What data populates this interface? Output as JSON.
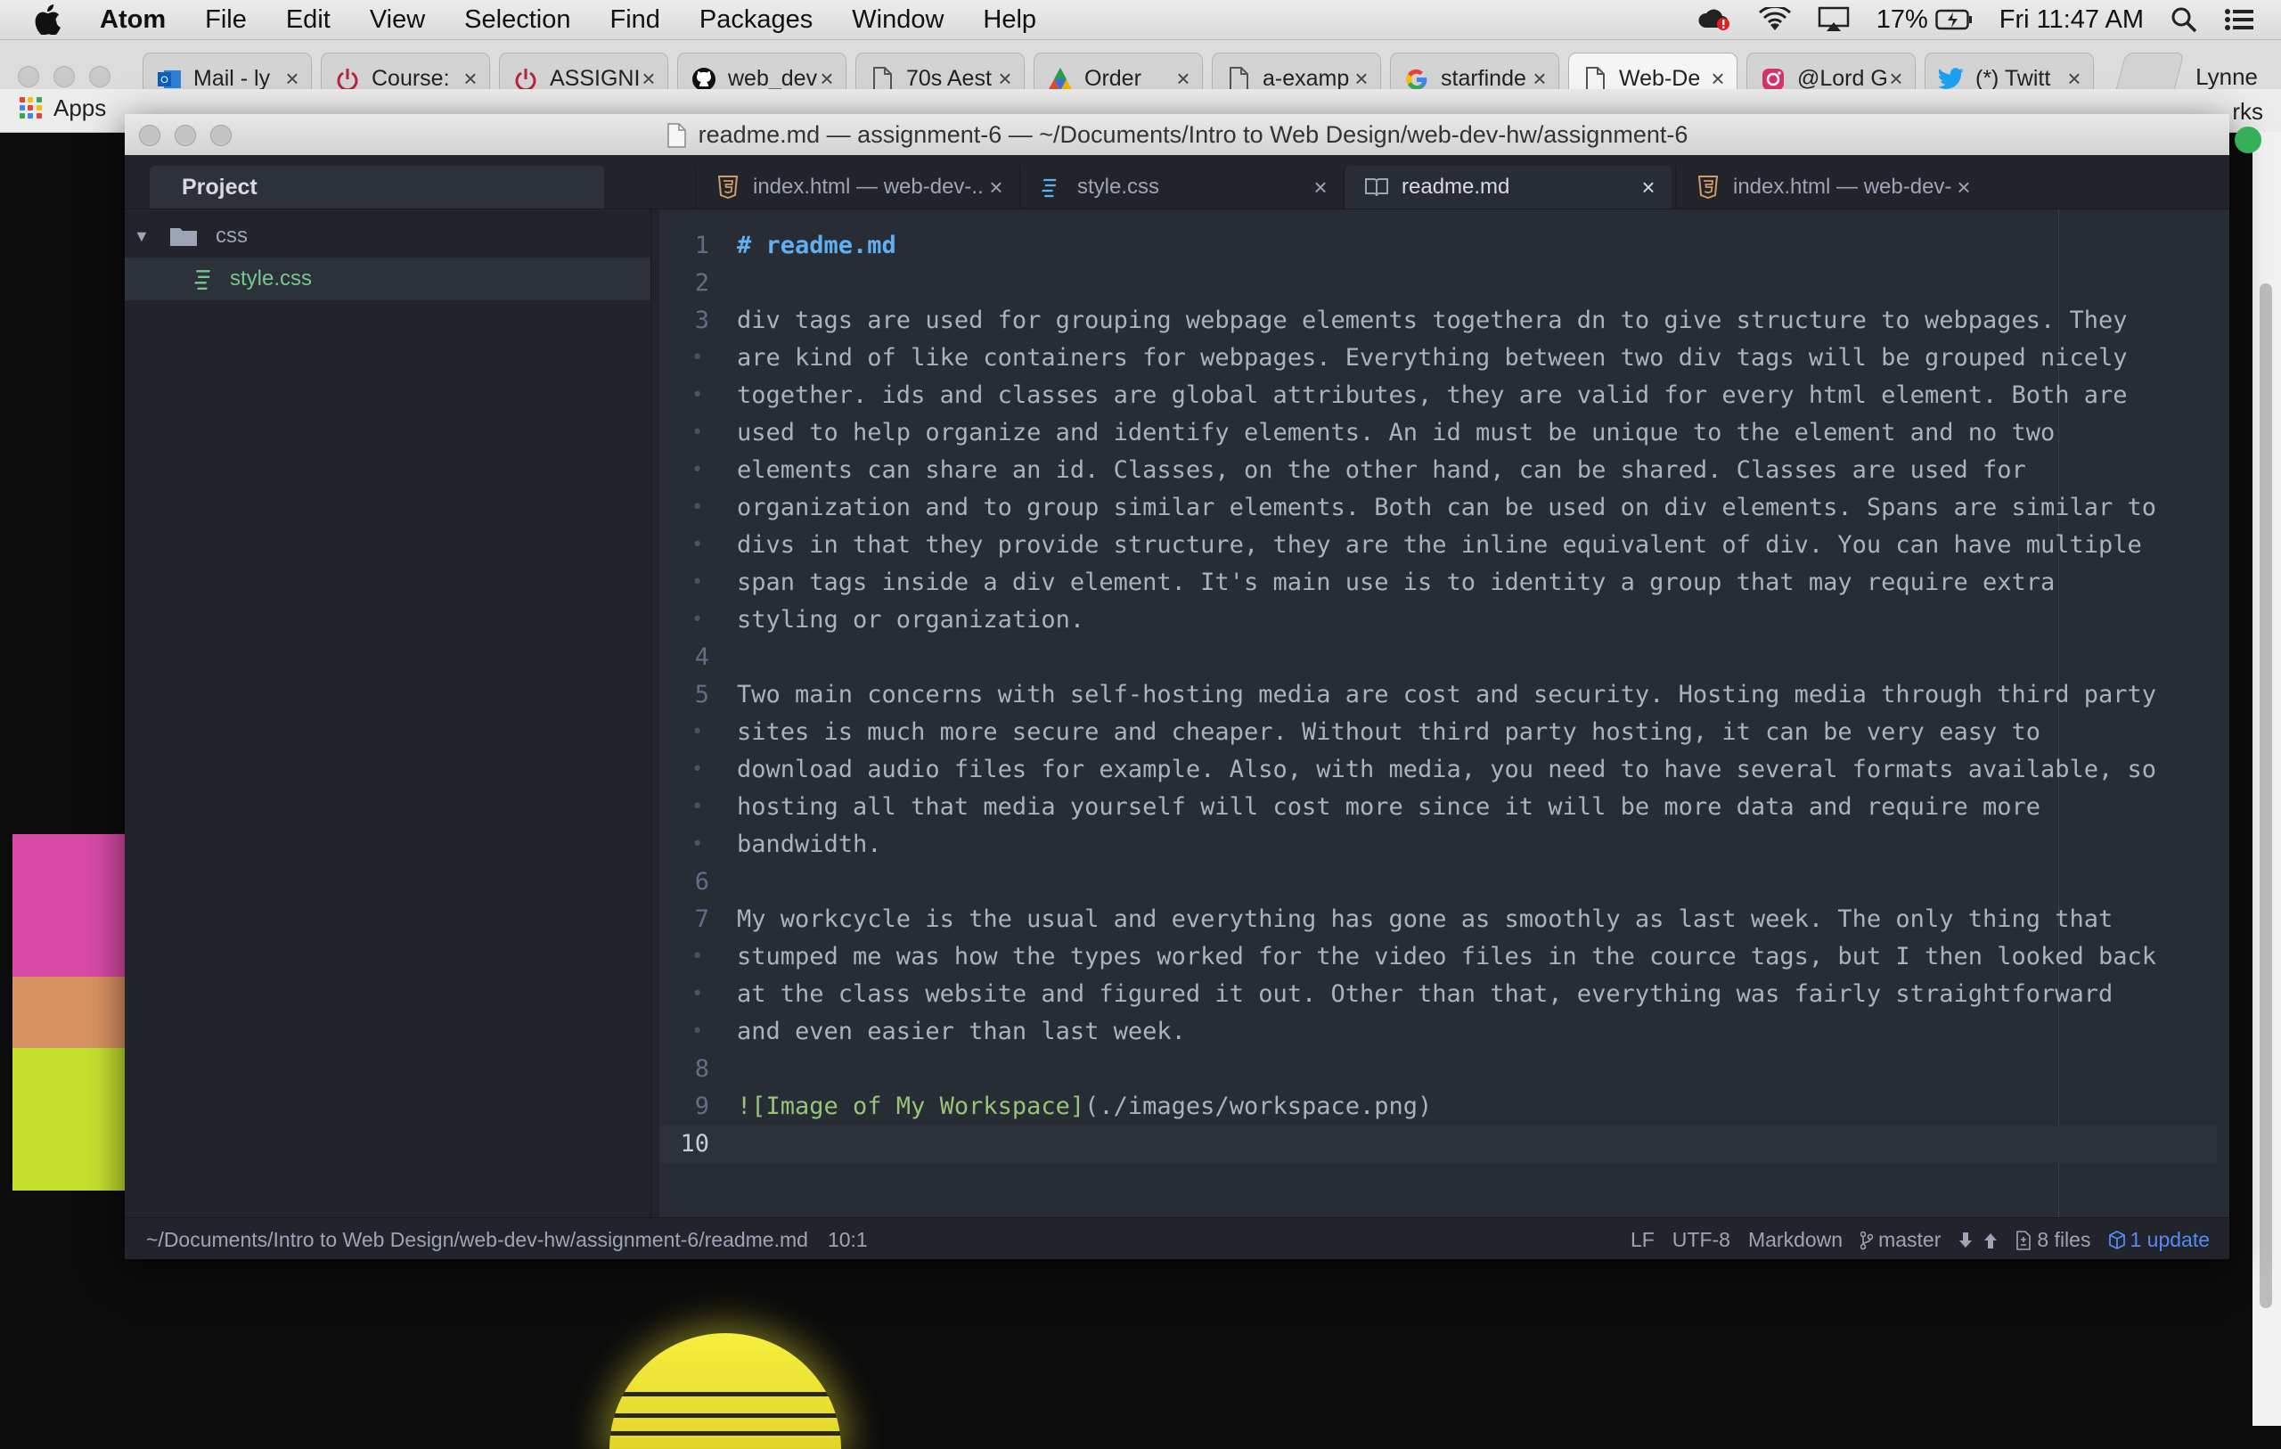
{
  "menubar": {
    "app": "Atom",
    "items": [
      "File",
      "Edit",
      "View",
      "Selection",
      "Find",
      "Packages",
      "Window",
      "Help"
    ],
    "battery": "17%",
    "clock": "Fri 11:47 AM"
  },
  "browser": {
    "tabs": [
      {
        "label": "Mail - ly",
        "icon": "outlook-icon"
      },
      {
        "label": "Course:",
        "icon": "power-icon"
      },
      {
        "label": "ASSIGNI",
        "icon": "power-icon"
      },
      {
        "label": "web_dev",
        "icon": "github-icon"
      },
      {
        "label": "70s Aest",
        "icon": "document-icon"
      },
      {
        "label": "Order",
        "icon": "diamond-logo-icon"
      },
      {
        "label": "a-examp",
        "icon": "document-icon"
      },
      {
        "label": "starfinde",
        "icon": "google-icon"
      },
      {
        "label": "Web-De",
        "icon": "document-icon"
      },
      {
        "label": "@Lord G",
        "icon": "instagram-icon"
      },
      {
        "label": "(*) Twitt",
        "icon": "twitter-icon"
      }
    ],
    "profile": "Lynne",
    "bookmarks": {
      "apps": "Apps",
      "right": "rks"
    }
  },
  "atom": {
    "window_title": "readme.md — assignment-6 — ~/Documents/Intro to Web Design/web-dev-hw/assignment-6",
    "project_tab": "Project",
    "tabs": [
      {
        "label": "index.html — web-dev-...",
        "icon": "html5-icon"
      },
      {
        "label": "style.css",
        "icon": "css3-icon"
      },
      {
        "label": "readme.md",
        "icon": "book-icon"
      },
      {
        "label": "index.html — web-dev-...",
        "icon": "html5-icon"
      }
    ],
    "tree": {
      "folder": "css",
      "file": "style.css"
    },
    "editor": {
      "lines": [
        {
          "num": "1",
          "text": "# readme.md"
        },
        {
          "num": "2",
          "text": ""
        },
        {
          "num": "3",
          "text": "div tags are used for grouping webpage elements togethera dn to give structure to webpages. They"
        },
        {
          "num": "",
          "text": "are kind of like containers for webpages. Everything between two div tags will be grouped nicely"
        },
        {
          "num": "",
          "text": "together. ids and classes are global attributes, they are valid for every html element. Both are"
        },
        {
          "num": "",
          "text": "used to help organize and identify elements. An id must be unique to the element and no two"
        },
        {
          "num": "",
          "text": "elements can share an id. Classes, on the other hand, can be shared. Classes are used for"
        },
        {
          "num": "",
          "text": "organization and to group similar elements. Both can be used on div elements. Spans are similar to"
        },
        {
          "num": "",
          "text": "divs in that they provide structure, they are the inline equivalent of div. You can have multiple"
        },
        {
          "num": "",
          "text": "span tags inside a div element. It's main use is to identity a group that may require extra"
        },
        {
          "num": "",
          "text": "styling or organization."
        },
        {
          "num": "4",
          "text": ""
        },
        {
          "num": "5",
          "text": "Two main concerns with self-hosting media are cost and security. Hosting media through third party"
        },
        {
          "num": "",
          "text": "sites is much more secure and cheaper. Without third party hosting, it can be very easy to"
        },
        {
          "num": "",
          "text": "download audio files for example. Also, with media, you need to have several formats available, so"
        },
        {
          "num": "",
          "text": "hosting all that media yourself will cost more since it will be more data and require more"
        },
        {
          "num": "",
          "text": "bandwidth."
        },
        {
          "num": "6",
          "text": ""
        },
        {
          "num": "7",
          "text": "My workcycle is the usual and everything has gone as smoothly as last week. The only thing that"
        },
        {
          "num": "",
          "text": "stumped me was how the types worked for the video files in the cource tags, but I then looked back"
        },
        {
          "num": "",
          "text": "at the class website and figured it out. Other than that, everything was fairly straightforward"
        },
        {
          "num": "",
          "text": "and even easier than last week."
        },
        {
          "num": "8",
          "text": ""
        },
        {
          "num": "9",
          "text": "![Image of My Workspace](./images/workspace.png)"
        },
        {
          "num": "10",
          "text": ""
        }
      ],
      "image_alt": "![Image of My Workspace]",
      "image_url": "(./images/workspace.png)"
    },
    "status": {
      "path": "~/Documents/Intro to Web Design/web-dev-hw/assignment-6/readme.md",
      "cursor": "10:1",
      "line_ending": "LF",
      "encoding": "UTF-8",
      "grammar": "Markdown",
      "branch": "master",
      "files": "8 files",
      "update": "1 update"
    }
  },
  "colors": {
    "atom_bg": "#282c34",
    "tree_bg": "#21252b",
    "heading": "#61afef",
    "link_alt": "#98c379",
    "added_file": "#73c990",
    "swatch_pink": "#d94aa7",
    "swatch_orange": "#d99362",
    "swatch_lime": "#c6e02e"
  }
}
